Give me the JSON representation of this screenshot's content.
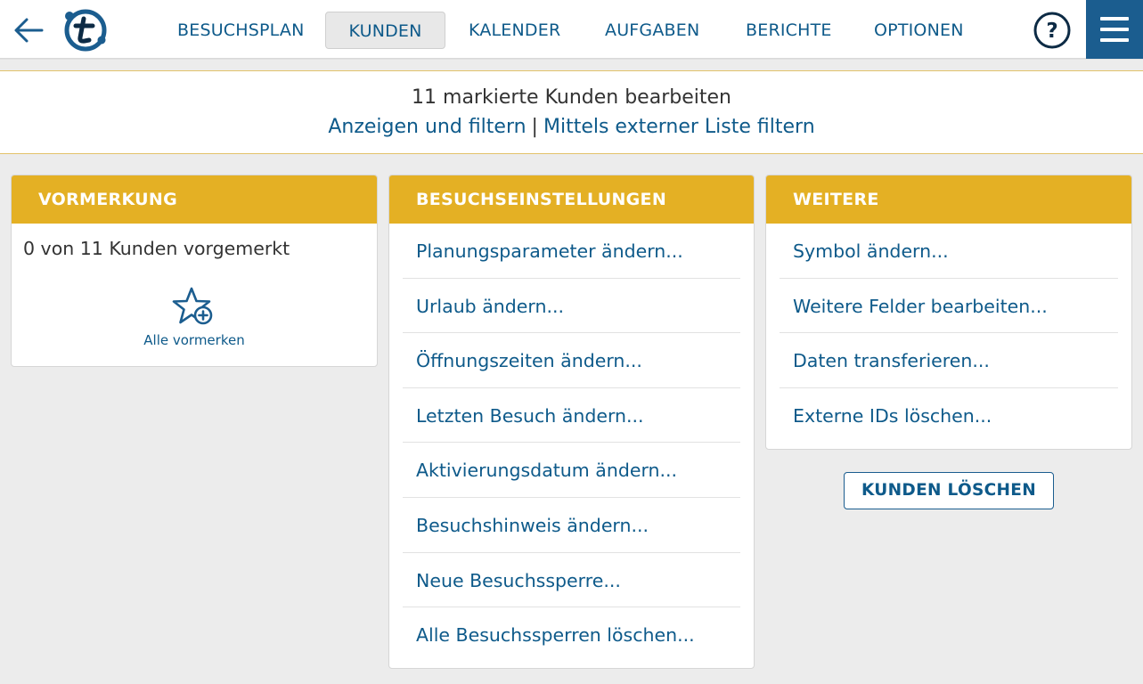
{
  "colors": {
    "brand_blue": "#1b5d8f",
    "link_blue": "#0e5a8a",
    "accent_yellow": "#e4b024",
    "background": "#ececec"
  },
  "topbar": {
    "back_icon": "arrow-left-icon",
    "logo_icon": "t-logo-icon",
    "nav": [
      {
        "label": "BESUCHSPLAN",
        "active": false
      },
      {
        "label": "KUNDEN",
        "active": true
      },
      {
        "label": "KALENDER",
        "active": false
      },
      {
        "label": "AUFGABEN",
        "active": false
      },
      {
        "label": "BERICHTE",
        "active": false
      },
      {
        "label": "OPTIONEN",
        "active": false
      }
    ],
    "help_icon": "question-circle-icon",
    "menu_icon": "hamburger-menu-icon"
  },
  "header": {
    "title": "11 markierte Kunden bearbeiten",
    "link_show_filter": "Anzeigen und filtern",
    "separator": "|",
    "link_external_list": "Mittels externer Liste filtern"
  },
  "panels": {
    "vormerkung": {
      "title": "VORMERKUNG",
      "count_text": "0 von 11 Kunden vorgemerkt",
      "mark_all_icon": "star-plus-icon",
      "mark_all_label": "Alle vormerken"
    },
    "besuchseinstellungen": {
      "title": "BESUCHSEINSTELLUNGEN",
      "items": [
        "Planungsparameter ändern...",
        "Urlaub ändern...",
        "Öffnungszeiten ändern...",
        "Letzten Besuch ändern...",
        "Aktivierungsdatum ändern...",
        "Besuchshinweis ändern...",
        "Neue Besuchssperre...",
        "Alle Besuchssperren löschen..."
      ]
    },
    "weitere": {
      "title": "WEITERE",
      "items": [
        "Symbol ändern...",
        "Weitere Felder bearbeiten...",
        "Daten transferieren...",
        "Externe IDs löschen..."
      ]
    }
  },
  "actions": {
    "delete_customers": "KUNDEN LÖSCHEN"
  }
}
